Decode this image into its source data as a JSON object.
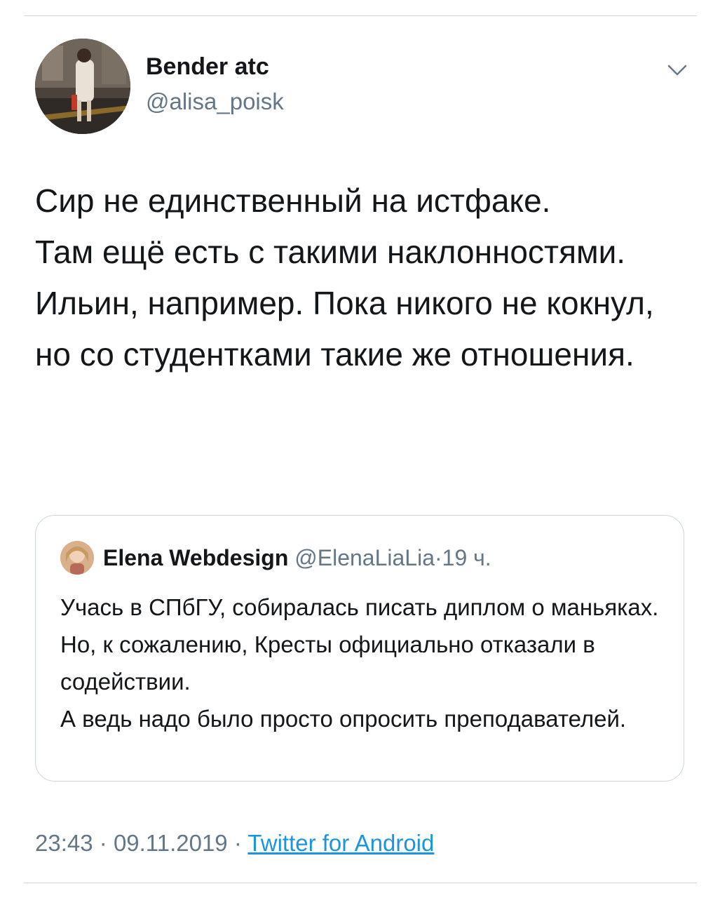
{
  "tweet": {
    "author": {
      "name": "Bender atc",
      "handle": "@alisa_poisk",
      "avatar_icon": "profile-photo"
    },
    "menu_icon": "chevron-down-icon",
    "text": "Сир не единственный на истфаке.\nТам ещё есть с такими наклонностями. Ильин, например. Пока никого не кокнул, но со студентками такие же отношения."
  },
  "quoted_tweet": {
    "author": {
      "name": "Elena Webdesign",
      "handle": "@ElenaLiaLia",
      "avatar_icon": "profile-photo"
    },
    "separator": "·",
    "time": "19 ч.",
    "text": "Учась в СПбГУ, собиралась писать диплом о маньяках. Но, к сожалению, Кресты официально отказали в содействии.\nА ведь надо было просто опросить преподавателей."
  },
  "meta": {
    "time": "23:43",
    "separator": "·",
    "date": "09.11.2019",
    "source": "Twitter for Android"
  },
  "colors": {
    "text": "#14171a",
    "secondary": "#657786",
    "link": "#1b95e0",
    "border": "#ccd6dd"
  }
}
